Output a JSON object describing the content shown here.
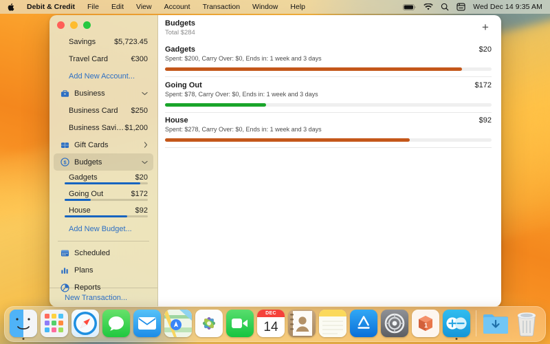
{
  "menubar": {
    "apple_icon": "apple-logo-icon",
    "app_name": "Debit & Credit",
    "items": [
      "File",
      "Edit",
      "View",
      "Account",
      "Transaction",
      "Window",
      "Help"
    ],
    "status_icons": [
      "battery-icon",
      "wifi-icon",
      "search-icon",
      "control-center-icon"
    ],
    "clock": "Wed Dec 14  9:35 AM"
  },
  "sidebar": {
    "accounts": [
      {
        "label": "Savings",
        "amount": "$5,723.45"
      },
      {
        "label": "Travel Card",
        "amount": "€300"
      }
    ],
    "add_account_link": "Add New Account...",
    "business": {
      "label": "Business",
      "icon": "briefcase-icon",
      "chevron": "chevron-down-icon",
      "items": [
        {
          "label": "Business Card",
          "amount": "$250"
        },
        {
          "label": "Business Savings",
          "amount": "$1,200"
        }
      ]
    },
    "gift_cards": {
      "label": "Gift Cards",
      "icon": "gift-card-icon",
      "chevron": "chevron-right-icon"
    },
    "budgets": {
      "label": "Budgets",
      "icon": "dollar-circle-icon",
      "chevron": "chevron-down-icon",
      "items": [
        {
          "label": "Gadgets",
          "amount": "$20",
          "progress": 91
        },
        {
          "label": "Going Out",
          "amount": "$172",
          "progress": 31
        },
        {
          "label": "House",
          "amount": "$92",
          "progress": 75
        }
      ],
      "add_link": "Add New Budget..."
    },
    "nav": [
      {
        "label": "Scheduled",
        "icon": "calendar-icon"
      },
      {
        "label": "Plans",
        "icon": "bar-chart-icon"
      },
      {
        "label": "Reports",
        "icon": "pie-chart-icon"
      }
    ],
    "footer_link": "New Transaction...",
    "accent_color": "#2d6fc4",
    "bar_color": "#1764c0"
  },
  "content": {
    "title": "Budgets",
    "subtitle": "Total $284",
    "add_button": "+",
    "budgets": [
      {
        "name": "Gadgets",
        "amount": "$20",
        "meta": "Spent: $200, Carry Over: $0, Ends in: 1 week and 3 days",
        "progress": 91,
        "color": "#c4571a"
      },
      {
        "name": "Going Out",
        "amount": "$172",
        "meta": "Spent: $78, Carry Over: $0, Ends in: 1 week and 3 days",
        "progress": 31,
        "color": "#19a52a"
      },
      {
        "name": "House",
        "amount": "$92",
        "meta": "Spent: $278, Carry Over: $0, Ends in: 1 week and 3 days",
        "progress": 75,
        "color": "#c4571a"
      }
    ]
  },
  "dock": {
    "apps": [
      "finder-icon",
      "launchpad-icon",
      "safari-icon",
      "messages-icon",
      "mail-icon",
      "maps-icon",
      "photos-icon",
      "facetime-icon",
      "calendar-icon",
      "contacts-icon",
      "notes-icon",
      "app-store-icon",
      "system-settings-icon",
      "package-icon",
      "debit-and-credit-icon"
    ],
    "calendar_month": "DEC",
    "calendar_day": "14",
    "folders": [
      "downloads-folder-icon",
      "trash-icon"
    ]
  }
}
